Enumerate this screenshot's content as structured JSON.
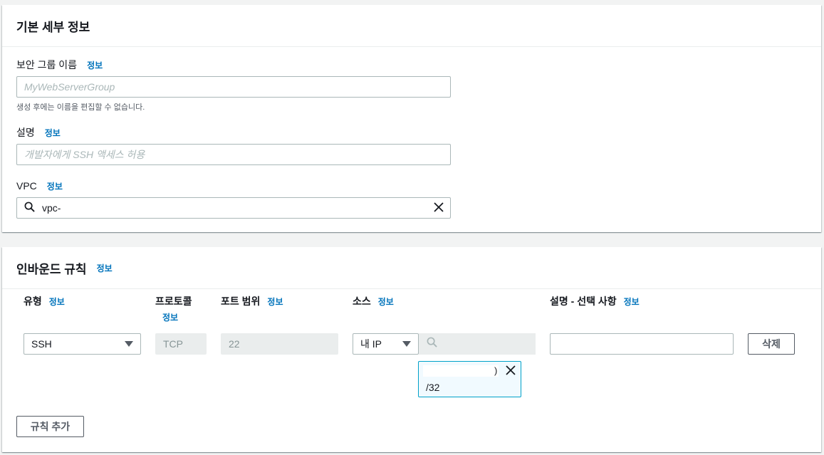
{
  "basic": {
    "title": "기본 세부 정보",
    "sg_name": {
      "label": "보안 그룹 이름",
      "info": "정보",
      "placeholder": "MyWebServerGroup",
      "hint": "생성 후에는 이름을 편집할 수 없습니다."
    },
    "description": {
      "label": "설명",
      "info": "정보",
      "placeholder": "개발자에게 SSH 액세스 허용"
    },
    "vpc": {
      "label": "VPC",
      "info": "정보",
      "value": "vpc-"
    }
  },
  "inbound": {
    "title": "인바운드 규칙",
    "info": "정보",
    "columns": {
      "type": {
        "label": "유형",
        "info": "정보"
      },
      "protocol": {
        "label": "프로토콜",
        "info": "정보"
      },
      "port_range": {
        "label": "포트 범위",
        "info": "정보"
      },
      "source": {
        "label": "소스",
        "info": "정보"
      },
      "description": {
        "label": "설명 - 선택 사항",
        "info": "정보"
      }
    },
    "rule": {
      "type": "SSH",
      "protocol": "TCP",
      "port": "22",
      "source_type": "내 IP",
      "source_token_suffix": ")",
      "source_cidr": "/32",
      "delete_label": "삭제"
    },
    "add_rule_label": "규칙 추가"
  },
  "colors": {
    "link": "#0073bb",
    "border": "#aab7b8",
    "disabled_bg": "#eaeded",
    "token_border": "#00a1c9",
    "token_bg": "#f1faff"
  },
  "icons": [
    "search-icon",
    "close-icon",
    "caret-down-icon"
  ]
}
